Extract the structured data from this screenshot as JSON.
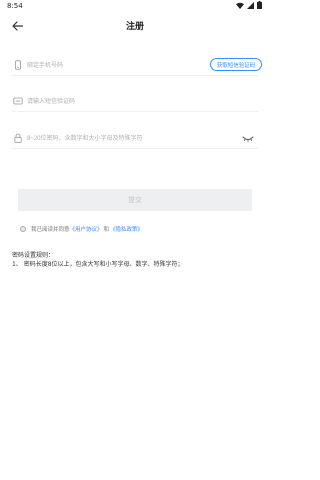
{
  "status_bar": {
    "time": "8:54"
  },
  "header": {
    "title": "注册"
  },
  "form": {
    "phone_placeholder": "绑定手机号码",
    "get_code_label": "获取短信验证码",
    "sms_placeholder": "请输入短信验证码",
    "password_placeholder": "8~20位密码，含数字和大小字母及特殊字符"
  },
  "submit_label": "提交",
  "agreement": {
    "prefix": "我已阅读并同意",
    "user_agreement": "《用户协议》",
    "and": "和",
    "privacy_policy": "《隐私政策》"
  },
  "password_rules": {
    "title": "密码设置规则：",
    "rule1": "1、 密码长度8位以上，包含大写和小写字母、数字、特殊字符；"
  }
}
